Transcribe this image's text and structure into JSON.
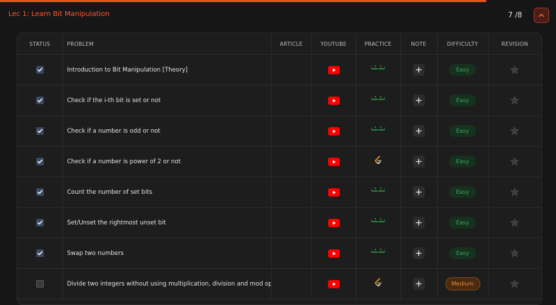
{
  "header": {
    "title": "Lec 1: Learn Bit Manipulation",
    "count": "7 /8"
  },
  "progress": 0.875,
  "columns": {
    "status": "STATUS",
    "problem": "PROBLEM",
    "article": "ARTICLE",
    "youtube": "YOUTUBE",
    "practice": "PRACTICE",
    "note": "NOTE",
    "difficulty": "DIFFICULTY",
    "revision": "REVISION"
  },
  "rows": [
    {
      "problem": "Introduction to Bit Manipulation [Theory]",
      "done": true,
      "practice": "gfg",
      "difficulty": "Easy"
    },
    {
      "problem": "Check if the i-th bit is set or not",
      "done": true,
      "practice": "gfg",
      "difficulty": "Easy"
    },
    {
      "problem": "Check if a number is odd or not",
      "done": true,
      "practice": "gfg",
      "difficulty": "Easy"
    },
    {
      "problem": "Check if a number is power of 2 or not",
      "done": true,
      "practice": "leetcode",
      "difficulty": "Easy"
    },
    {
      "problem": "Count the number of set bits",
      "done": true,
      "practice": "gfg",
      "difficulty": "Easy"
    },
    {
      "problem": "Set/Unset the rightmost unset bit",
      "done": true,
      "practice": "gfg",
      "difficulty": "Easy"
    },
    {
      "problem": "Swap two numbers",
      "done": true,
      "practice": "gfg",
      "difficulty": "Easy"
    },
    {
      "problem": "Divide two integers without using multiplication, division and mod operator",
      "done": false,
      "practice": "leetcode",
      "difficulty": "Medium"
    }
  ],
  "icons": {
    "youtube": "youtube-icon",
    "gfg": "geeksforgeeks-icon",
    "leetcode": "leetcode-icon",
    "note": "plus-icon",
    "revision": "star-icon",
    "collapse": "chevron-up-icon"
  },
  "colors": {
    "accent": "#e8501e",
    "youtube": "#ff0000",
    "gfg": "#2f8d46",
    "easy": "#3fa55a",
    "medium": "#e8913a"
  }
}
